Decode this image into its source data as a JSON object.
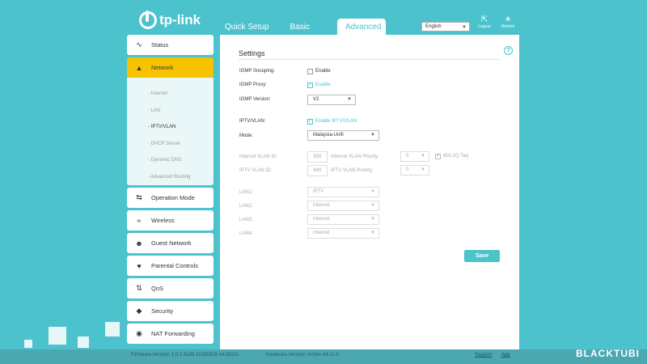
{
  "header": {
    "logo_text": "tp-link",
    "tabs": [
      "Quick Setup",
      "Basic",
      "Advanced"
    ],
    "language": "English",
    "logout_label": "Logout",
    "reboot_label": "Reboot"
  },
  "sidebar": {
    "items": [
      {
        "label": "Status",
        "icon": "pulse-icon"
      },
      {
        "label": "Network",
        "icon": "network-icon"
      },
      {
        "label": "Operation Mode",
        "icon": "mode-icon"
      },
      {
        "label": "Wireless",
        "icon": "wifi-icon"
      },
      {
        "label": "Guest Network",
        "icon": "guest-icon"
      },
      {
        "label": "Parental Controls",
        "icon": "heart-icon"
      },
      {
        "label": "QoS",
        "icon": "qos-icon"
      },
      {
        "label": "Security",
        "icon": "shield-icon"
      },
      {
        "label": "NAT Forwarding",
        "icon": "nat-icon"
      }
    ],
    "network_sub": [
      "Internet",
      "LAN",
      "IPTV/VLAN",
      "DHCP Server",
      "Dynamic DNS",
      "Advanced Routing"
    ]
  },
  "main": {
    "title": "Settings",
    "igmp_snooping_label": "IGMP Snooping:",
    "igmp_snooping_cb": "Enable",
    "igmp_proxy_label": "IGMP Proxy:",
    "igmp_proxy_cb": "Enable",
    "igmp_version_label": "IGMP Version:",
    "igmp_version_value": "V2",
    "iptv_label": "IPTV/VLAN:",
    "iptv_cb": "Enable IPTV/VLAN",
    "mode_label": "Mode:",
    "mode_value": "Malaysia-Unifi",
    "internet_vlan_id_label": "Internet VLAN ID:",
    "internet_vlan_id_value": "500",
    "internet_vlan_priority_label": "Internet VLAN Priority:",
    "internet_vlan_priority_value": "0",
    "tag_label": "802.1Q Tag",
    "iptv_vlan_id_label": "IPTV VLAN ID:",
    "iptv_vlan_id_value": "600",
    "iptv_vlan_priority_label": "IPTV VLAN Priority:",
    "iptv_vlan_priority_value": "0",
    "lan1_label": "LAN1:",
    "lan1_value": "IPTV",
    "lan2_label": "LAN2:",
    "lan2_value": "Internet",
    "lan3_label": "LAN3:",
    "lan3_value": "Internet",
    "lan4_label": "LAN4:",
    "lan4_value": "Internet",
    "save_label": "Save"
  },
  "footer": {
    "firmware": "Firmware Version: 1.0.1 Build 20180928 rel.58151",
    "hardware": "Hardware Version: Archer A6 v2.0",
    "support": "Support",
    "app": "App",
    "watermark": "BLACKTUBI"
  },
  "colors": {
    "accent": "#4cc3cc",
    "active": "#f6c300"
  }
}
